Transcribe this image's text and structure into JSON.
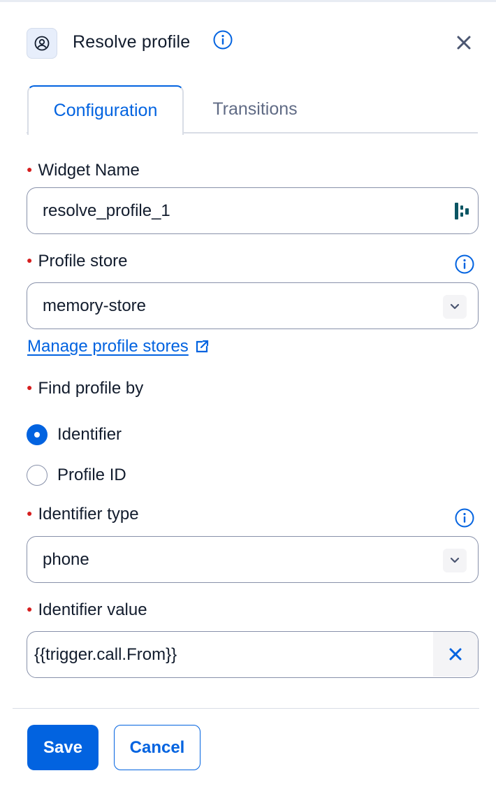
{
  "header": {
    "title": "Resolve profile",
    "icon": "user-circle-icon",
    "info_icon": "info-icon",
    "close_icon": "close-icon"
  },
  "tabs": [
    {
      "label": "Configuration",
      "active": true
    },
    {
      "label": "Transitions",
      "active": false
    }
  ],
  "form": {
    "widget_name": {
      "label": "Widget Name",
      "value": "resolve_profile_1",
      "required": true
    },
    "profile_store": {
      "label": "Profile store",
      "value": "memory-store",
      "required": true
    },
    "manage_link": {
      "label": "Manage profile stores",
      "icon": "external-link-icon"
    },
    "find_by": {
      "label": "Find profile by",
      "required": true,
      "options": [
        {
          "label": "Identifier",
          "checked": true
        },
        {
          "label": "Profile ID",
          "checked": false
        }
      ]
    },
    "identifier_type": {
      "label": "Identifier type",
      "value": "phone",
      "required": true
    },
    "identifier_value": {
      "label": "Identifier value",
      "value": "{{trigger.call.From}}",
      "required": true
    }
  },
  "footer": {
    "save_label": "Save",
    "cancel_label": "Cancel"
  },
  "colors": {
    "accent": "#0263e0",
    "required": "#d61f1f",
    "border": "#8891aa",
    "text": "#121c2d",
    "muted": "#606b85"
  }
}
